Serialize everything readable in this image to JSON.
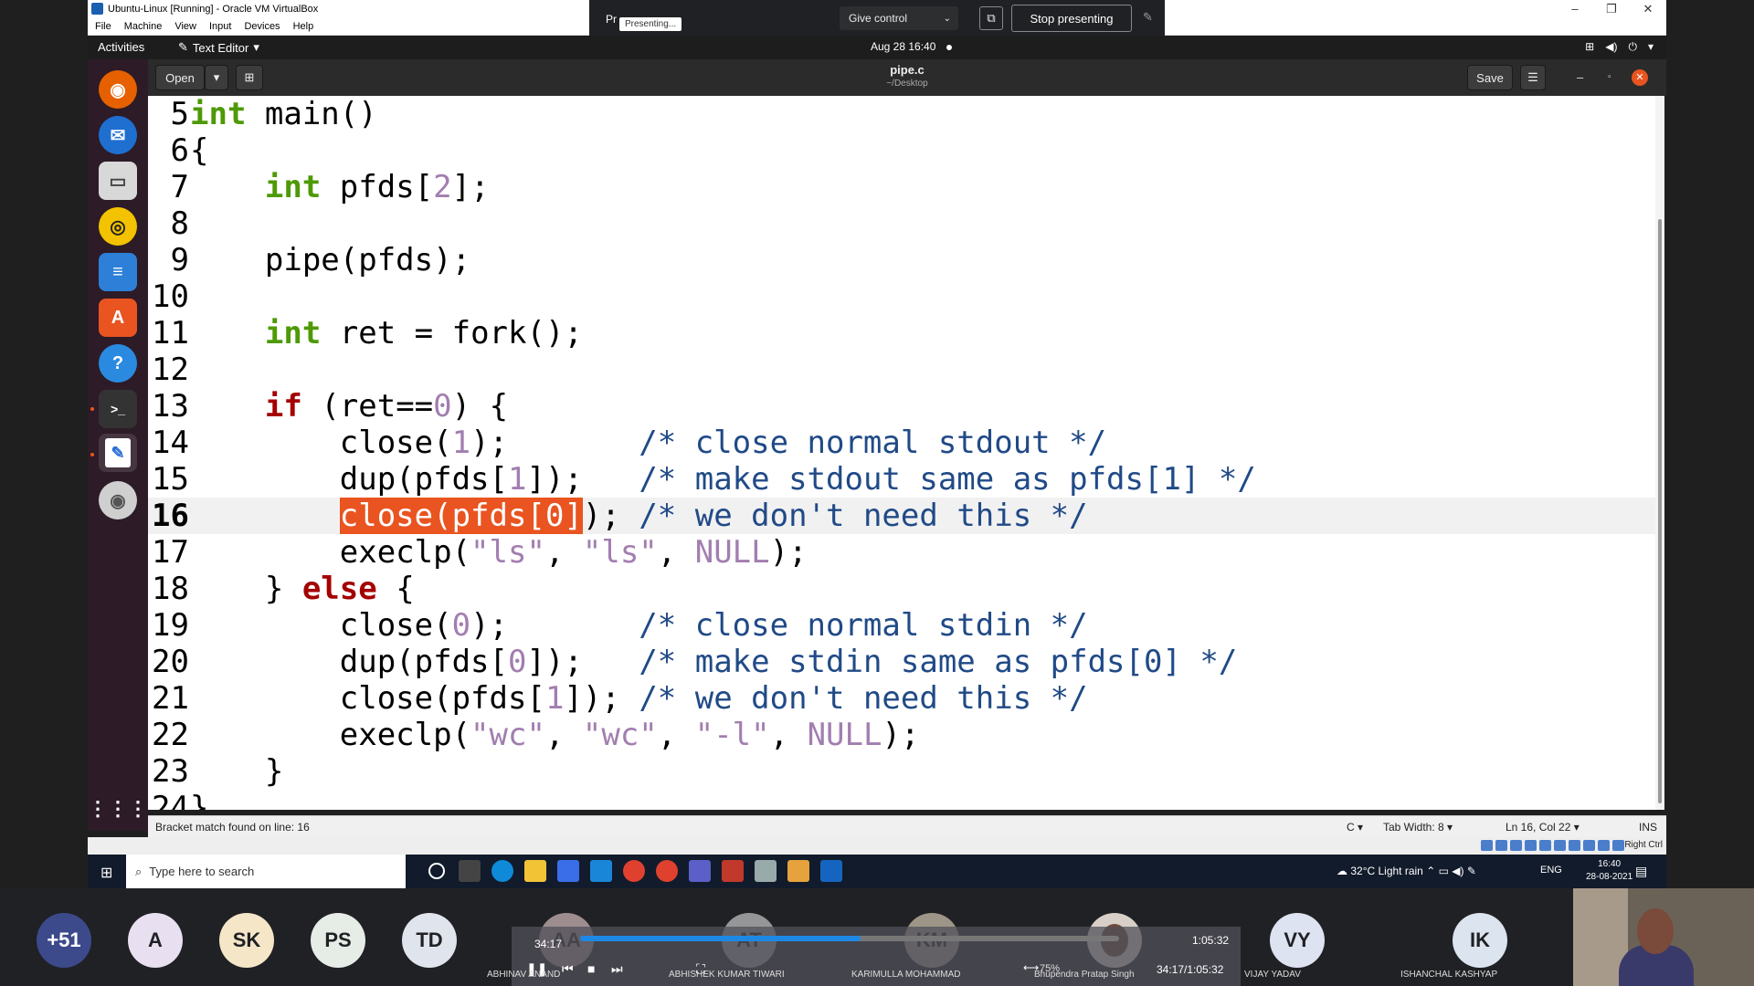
{
  "vbox": {
    "title": "Ubuntu-Linux [Running] - Oracle VM VirtualBox",
    "menu": [
      "File",
      "Machine",
      "View",
      "Input",
      "Devices",
      "Help"
    ],
    "right_ctrl": "Right Ctrl"
  },
  "presenting": {
    "label": "Pr",
    "tooltip": "Presenting...",
    "give_control": "Give control",
    "stop": "Stop presenting"
  },
  "ubuntu": {
    "activities": "Activities",
    "app_menu": "Text Editor",
    "clock": "Aug 28  16:40"
  },
  "gedit": {
    "open": "Open",
    "save": "Save",
    "title": "pipe.c",
    "subtitle": "~/Desktop"
  },
  "code": {
    "current_line": "16",
    "lines": [
      {
        "n": "5"
      },
      {
        "n": "6"
      },
      {
        "n": "7"
      },
      {
        "n": "8"
      },
      {
        "n": "9"
      },
      {
        "n": "10"
      },
      {
        "n": "11"
      },
      {
        "n": "12"
      },
      {
        "n": "13"
      },
      {
        "n": "14"
      },
      {
        "n": "15"
      },
      {
        "n": "16"
      },
      {
        "n": "17"
      },
      {
        "n": "18"
      },
      {
        "n": "19"
      },
      {
        "n": "20"
      },
      {
        "n": "21"
      },
      {
        "n": "22"
      },
      {
        "n": "23"
      },
      {
        "n": "24"
      }
    ]
  },
  "status": {
    "message": "Bracket match found on line: 16",
    "language": "C",
    "tab_width": "Tab Width: 8",
    "position": "Ln 16, Col 22",
    "mode": "INS"
  },
  "taskbar": {
    "search_placeholder": "Type here to search",
    "weather": "32°C  Light rain",
    "lang": "ENG",
    "time": "16:40",
    "date": "28-08-2021"
  },
  "meet": {
    "participants": [
      {
        "initials": "+51",
        "color": "#3c4a8c"
      },
      {
        "initials": "A",
        "color": "#e8e0f0"
      },
      {
        "initials": "SK",
        "color": "#f5e6c8"
      },
      {
        "initials": "PS",
        "color": "#e6ece6"
      },
      {
        "initials": "TD",
        "color": "#e0e4ec"
      },
      {
        "initials": "AA",
        "color": "#f3d6d6"
      },
      {
        "initials": "AT",
        "color": "#e4e4e4"
      },
      {
        "initials": "KM",
        "color": "#f1e2c9"
      },
      {
        "initials": "VY",
        "color": "#dde3f0"
      },
      {
        "initials": "IK",
        "color": "#dbe4ef"
      }
    ],
    "names": [
      "ABHINAV ANAND",
      "ABHISHEK KUMAR TIWARI",
      "KARIMULLA MOHAMMAD",
      "Bhupendra Pratap Singh",
      "VIJAY YADAV",
      "ISHANCHAL KASHYAP"
    ],
    "player": {
      "elapsed": "34:17",
      "total": "1:05:32",
      "combined": "34:17/1:05:32",
      "zoom": "75%",
      "progress_fraction": 0.52
    }
  }
}
